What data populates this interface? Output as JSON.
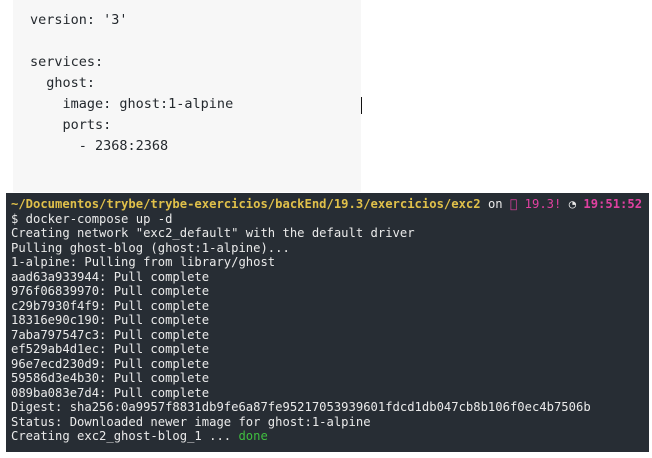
{
  "compose_file": {
    "lines": [
      "version: '3'",
      "",
      "services:",
      "  ghost:",
      "    image: ghost:1-alpine",
      "    ports:",
      "      - 2368:2368"
    ]
  },
  "terminal": {
    "prompt": {
      "path": "~/Documentos/trybe/trybe-exercicios/backEnd/19.3/exercicios/exc2",
      "on": " on ",
      "branch": " 19.3!",
      "clock": "◔",
      "time": "19:51:52"
    },
    "command": "$ docker-compose up -d",
    "output": [
      "Creating network \"exc2_default\" with the default driver",
      "Pulling ghost-blog (ghost:1-alpine)...",
      "1-alpine: Pulling from library/ghost",
      "aad63a933944: Pull complete",
      "976f06839970: Pull complete",
      "c29b7930f4f9: Pull complete",
      "18316e90c190: Pull complete",
      "7aba797547c3: Pull complete",
      "ef529ab4d1ec: Pull complete",
      "96e7ecd230d9: Pull complete",
      "59586d3e4b30: Pull complete",
      "089ba083e7d4: Pull complete",
      "Digest: sha256:0a9957f8831db9fe6a87fe95217053939601fdcd1db047cb8b106f0ec4b7506b",
      "Status: Downloaded newer image for ghost:1-alpine"
    ],
    "last_line_prefix": "Creating exc2_ghost-blog_1 ... ",
    "last_line_status": "done"
  },
  "colors": {
    "terminal_bg": "#272d34",
    "path": "#e0c04a",
    "branch": "#e040a0",
    "done": "#3fbf3f"
  }
}
